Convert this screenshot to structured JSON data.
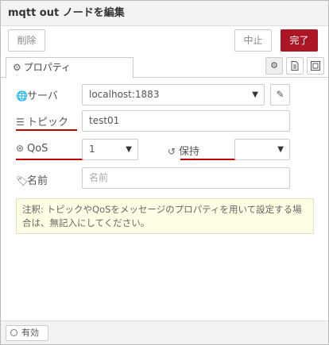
{
  "window": {
    "title": "mqtt out ノードを編集"
  },
  "toolbar": {
    "delete_label": "削除",
    "cancel_label": "中止",
    "done_label": "完了"
  },
  "tabs": [
    {
      "label": "プロパティ",
      "icon": "gear-icon"
    }
  ],
  "side_buttons": [
    "gear-icon",
    "document-icon",
    "frame-icon"
  ],
  "form": {
    "server": {
      "label": "サーバ",
      "value": "localhost:1883",
      "icon": "globe-icon",
      "edit_icon": "pencil-icon"
    },
    "topic": {
      "label": "トピック",
      "value": "test01",
      "icon": "tasks-icon"
    },
    "qos": {
      "label": "QoS",
      "value": "1",
      "icon": "qos-icon"
    },
    "retain": {
      "label": "保持",
      "value": "",
      "icon": "history-icon"
    },
    "name": {
      "label": "名前",
      "value": "",
      "placeholder": "名前",
      "icon": "tag-icon"
    }
  },
  "tip": {
    "text": "注釈: トピックやQoSをメッセージのプロパティを用いて設定する場合は、無記入にしてください。"
  },
  "footer": {
    "enabled_label": "有効"
  },
  "colors": {
    "primary": "#ad1625",
    "annotation_underline": "#c00000",
    "tip_background": "#ffffe6"
  }
}
